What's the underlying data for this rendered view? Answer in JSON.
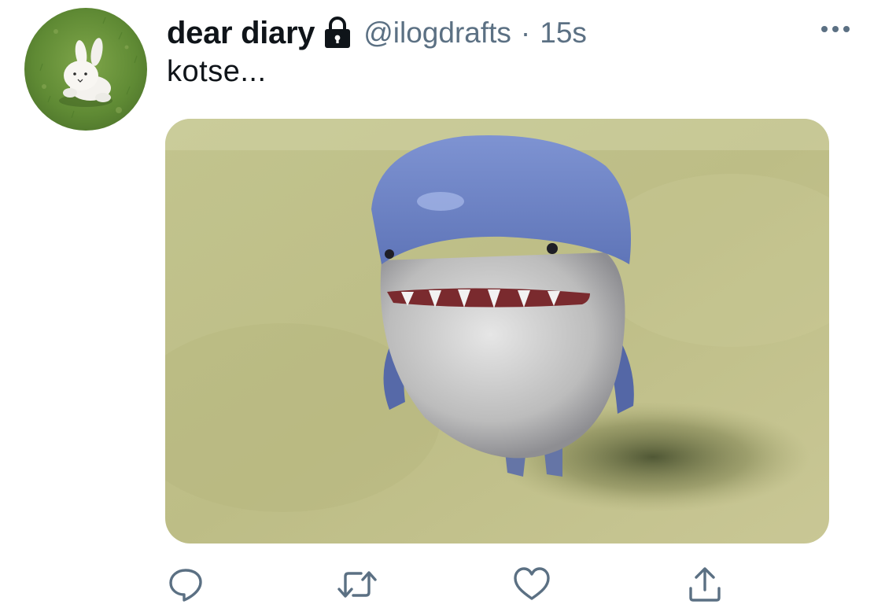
{
  "tweet": {
    "author": {
      "display_name": "dear diary",
      "handle": "@ilogdrafts",
      "protected_icon": "lock-icon",
      "avatar_icon": "bunny-plush-avatar"
    },
    "separator": "·",
    "timestamp": "15s",
    "text": "kotse...",
    "media": {
      "description_icon": "shark-photo"
    },
    "actions": [
      {
        "name": "reply",
        "icon": "reply-icon"
      },
      {
        "name": "retweet",
        "icon": "retweet-icon"
      },
      {
        "name": "like",
        "icon": "heart-icon"
      },
      {
        "name": "share",
        "icon": "share-icon"
      }
    ],
    "more_icon": "more-icon"
  },
  "colors": {
    "text_primary": "#0f1419",
    "text_secondary": "#5b7083",
    "background": "#ffffff"
  }
}
